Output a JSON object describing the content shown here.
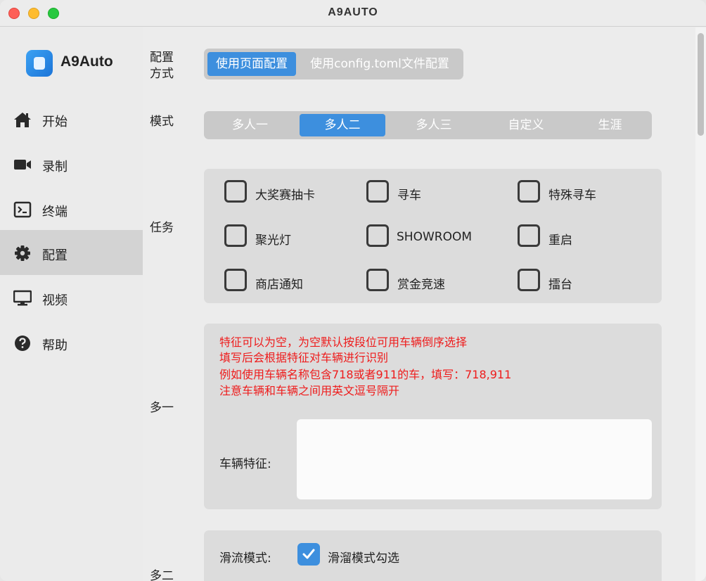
{
  "window": {
    "title": "A9AUTO"
  },
  "app": {
    "name": "A9Auto"
  },
  "sidebar": {
    "items": [
      {
        "label": "开始",
        "icon": "home-icon"
      },
      {
        "label": "录制",
        "icon": "video-camera-icon"
      },
      {
        "label": "终端",
        "icon": "terminal-icon"
      },
      {
        "label": "配置",
        "icon": "gear-icon",
        "active": true
      },
      {
        "label": "视频",
        "icon": "monitor-icon"
      },
      {
        "label": "帮助",
        "icon": "help-icon"
      }
    ]
  },
  "config_method": {
    "label": "配置\n方式",
    "label_line1": "配置",
    "label_line2": "方式",
    "options": [
      "使用页面配置",
      "使用config.toml文件配置"
    ],
    "selected": "使用页面配置"
  },
  "mode": {
    "label": "模式",
    "options": [
      "多人一",
      "多人二",
      "多人三",
      "自定义",
      "生涯"
    ],
    "selected": "多人二"
  },
  "tasks": {
    "label": "任务",
    "items": [
      {
        "label": "大奖赛抽卡",
        "checked": false
      },
      {
        "label": "寻车",
        "checked": false
      },
      {
        "label": "特殊寻车",
        "checked": false
      },
      {
        "label": "聚光灯",
        "checked": false
      },
      {
        "label": "SHOWROOM",
        "checked": false
      },
      {
        "label": "重启",
        "checked": false
      },
      {
        "label": "商店通知",
        "checked": false
      },
      {
        "label": "赏金竞速",
        "checked": false
      },
      {
        "label": "擂台",
        "checked": false
      }
    ]
  },
  "multi1": {
    "label": "多一",
    "hints": [
      "特征可以为空，为空默认按段位可用车辆倒序选择",
      "填写后会根据特征对车辆进行识别",
      "例如使用车辆名称包含718或者911的车，填写：718,911",
      "注意车辆和车辆之间用英文逗号隔开"
    ],
    "vehicle_feature_label": "车辆特征:",
    "vehicle_feature_value": ""
  },
  "multi2": {
    "label": "多二",
    "slipstream_label": "滑流模式:",
    "slipstream_checkbox_label": "滑溜模式勾选",
    "slipstream_checked": true
  },
  "colors": {
    "accent": "#3d8fde",
    "hint_red": "#ee1c1c",
    "segment_bg": "#c9c9c9",
    "panel_bg": "#dcdcdc"
  }
}
